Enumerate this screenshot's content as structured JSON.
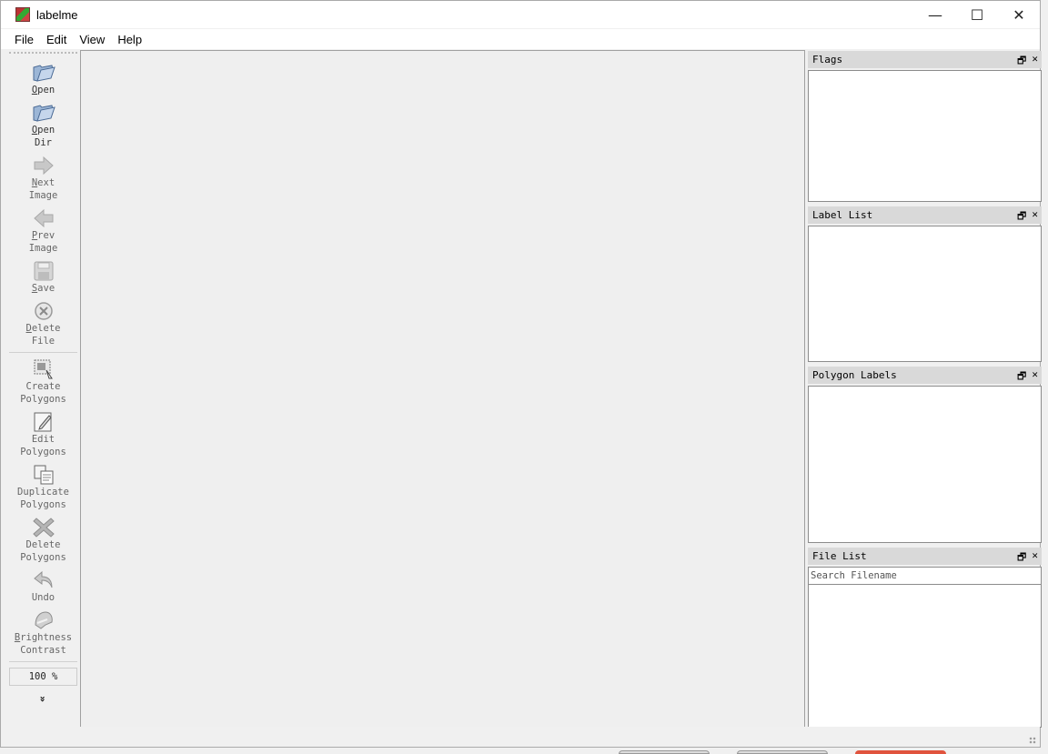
{
  "window": {
    "title": "labelme",
    "minimize": "—",
    "maximize": "☐",
    "close": "✕"
  },
  "menu": [
    "File",
    "Edit",
    "View",
    "Help"
  ],
  "toolbar": {
    "tools": [
      {
        "name": "open",
        "mn": "O",
        "rest": "pen",
        "label2": ""
      },
      {
        "name": "open-dir",
        "mn": "O",
        "rest": "pen",
        "label2": "Dir"
      },
      {
        "name": "next-image",
        "mn": "N",
        "rest": "ext",
        "label2": "Image"
      },
      {
        "name": "prev-image",
        "mn": "P",
        "rest": "rev",
        "label2": "Image"
      },
      {
        "name": "save",
        "mn": "S",
        "rest": "ave",
        "label2": ""
      },
      {
        "name": "delete-file",
        "mn": "D",
        "rest": "elete",
        "label2": "File"
      }
    ],
    "tools2": [
      {
        "name": "create-polygons",
        "label": "Create\nPolygons"
      },
      {
        "name": "edit-polygons",
        "label": "Edit\nPolygons"
      },
      {
        "name": "duplicate-polygons",
        "label": "Duplicate\nPolygons"
      },
      {
        "name": "delete-polygons",
        "label": "Delete\nPolygons"
      },
      {
        "name": "undo",
        "label": "Undo"
      }
    ],
    "brightness": {
      "mn": "B",
      "rest": "rightness",
      "label2": "Contrast"
    },
    "zoom": "100 %",
    "extension": "»"
  },
  "docks": {
    "flags": {
      "title": "Flags"
    },
    "label_list": {
      "title": "Label List"
    },
    "polygon_labels": {
      "title": "Polygon Labels"
    },
    "file_list": {
      "title": "File List",
      "search_placeholder": "Search Filename"
    },
    "float_icon": "🗗",
    "close_icon": "✕"
  }
}
